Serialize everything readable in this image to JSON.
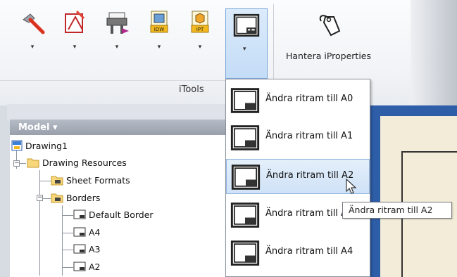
{
  "ribbon": {
    "panel_label": "iTools",
    "manage_iproperties_label": "Hantera iProperties",
    "buttons": [
      {
        "icon": "hammer-icon"
      },
      {
        "icon": "drawing-pen-icon"
      },
      {
        "icon": "plotter-icon"
      },
      {
        "icon": "export-idw-icon",
        "badge": "IDW"
      },
      {
        "icon": "export-ipt-icon",
        "badge": "IPT"
      },
      {
        "icon": "drawing-border-icon"
      }
    ],
    "dropdown_arrow": "▾"
  },
  "browser": {
    "title": "Model ▾",
    "tree": {
      "root": "Drawing1",
      "resources": "Drawing Resources",
      "sheet_formats": "Sheet Formats",
      "borders": "Borders",
      "border_items": [
        "Default Border",
        "A4",
        "A3",
        "A2"
      ],
      "minus": "−"
    }
  },
  "menu": {
    "items": [
      {
        "label": "Ändra ritram till A0"
      },
      {
        "label": "Ändra ritram till A1"
      },
      {
        "label": "Ändra ritram till A2"
      },
      {
        "label": "Ändra ritram till A3"
      },
      {
        "label": "Ändra ritram till A4"
      }
    ],
    "hover_index": 2
  },
  "tooltip": {
    "text": "Ändra ritram till A2"
  },
  "colors": {
    "accent": "#2e5ea8",
    "menu_hover": "#cfe2f7",
    "ribbon": "#f1f3f6"
  }
}
